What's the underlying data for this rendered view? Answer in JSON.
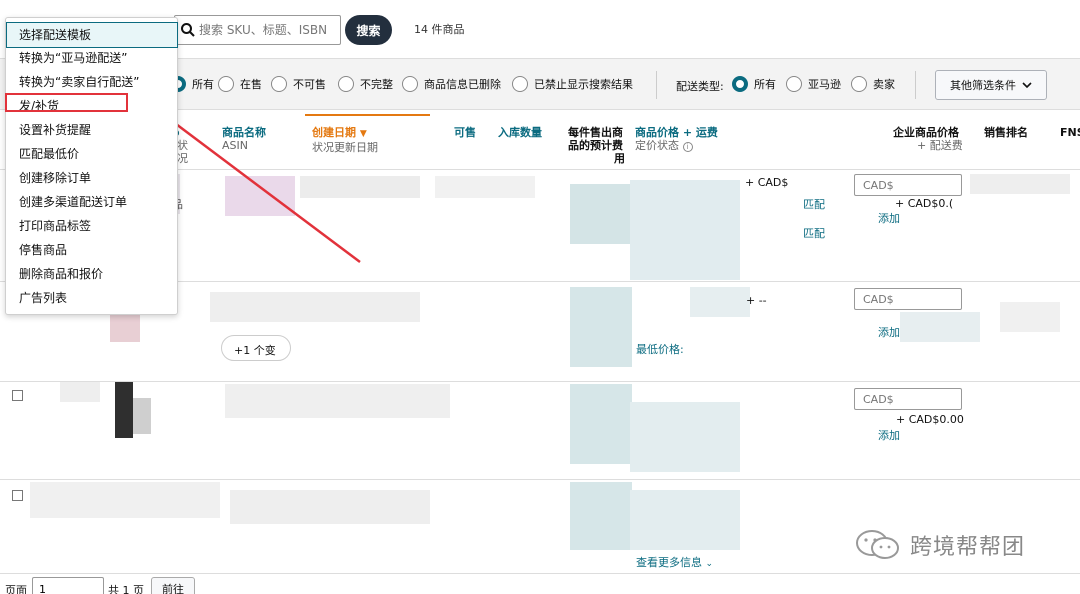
{
  "search": {
    "placeholder": "搜索 SKU、标题、ISBN",
    "button_label": "搜索"
  },
  "item_count": "14 件商品",
  "status_filter": {
    "options": [
      "所有",
      "在售",
      "不可售",
      "不完整",
      "商品信息已删除",
      "已禁止显示搜索结果"
    ],
    "selected": "所有"
  },
  "fulfillment_filter": {
    "title": "配送类型:",
    "options": [
      "所有",
      "亚马逊",
      "卖家"
    ],
    "selected": "所有"
  },
  "more_filters_label": "其他筛选条件",
  "columns": {
    "status_main": "状况",
    "name_main": "商品名称",
    "name_sub": "ASIN",
    "created_main": "创建日期",
    "created_sub": "状况更新日期",
    "available": "可售",
    "inbound": "入库数量",
    "fee_line1": "每件售出商",
    "fee_line2": "品的预计费",
    "fee_line3": "用",
    "price_main": "商品价格 + 运费",
    "price_sub": "定价状态",
    "biz_main": "企业商品价格",
    "biz_sub": "+ 配送费",
    "rank": "销售排名",
    "fnsku": "FNS"
  },
  "rows": {
    "row1": {
      "cad_placeholder": "CAD$",
      "plus_cad": "+ CAD$0.(",
      "add": "添加",
      "match1": "匹配",
      "match2": "匹配",
      "plus_cad_left": "+ CAD$",
      "dot_char": "品"
    },
    "row2": {
      "cad_placeholder": "CAD$",
      "add": "添加",
      "plus_dash": "+ --",
      "lowest": "最低价格:",
      "more_count": "+1 个变"
    },
    "row3": {
      "cad_placeholder": "CAD$",
      "plus_cad": "+ CAD$0.00",
      "add": "添加"
    },
    "row4": {
      "see_more": "查看更多信息"
    }
  },
  "menu": {
    "items": [
      "选择配送模板",
      "转换为“亚马逊配送”",
      "转换为“卖家自行配送”",
      "发/补货",
      "设置补货提醒",
      "匹配最低价",
      "创建移除订单",
      "创建多渠道配送订单",
      "打印商品标签",
      "停售商品",
      "删除商品和报价",
      "广告列表"
    ],
    "highlighted": "发/补货"
  },
  "pagination": {
    "page_label": "页面",
    "page_value": "1",
    "total_label": "共 1 页",
    "go_label": "前往"
  },
  "watermark": "跨境帮帮团",
  "colors": {
    "teal": "#0b6b80",
    "orange": "#e47911",
    "dark": "#232f3e",
    "arrow": "#e2323b"
  }
}
